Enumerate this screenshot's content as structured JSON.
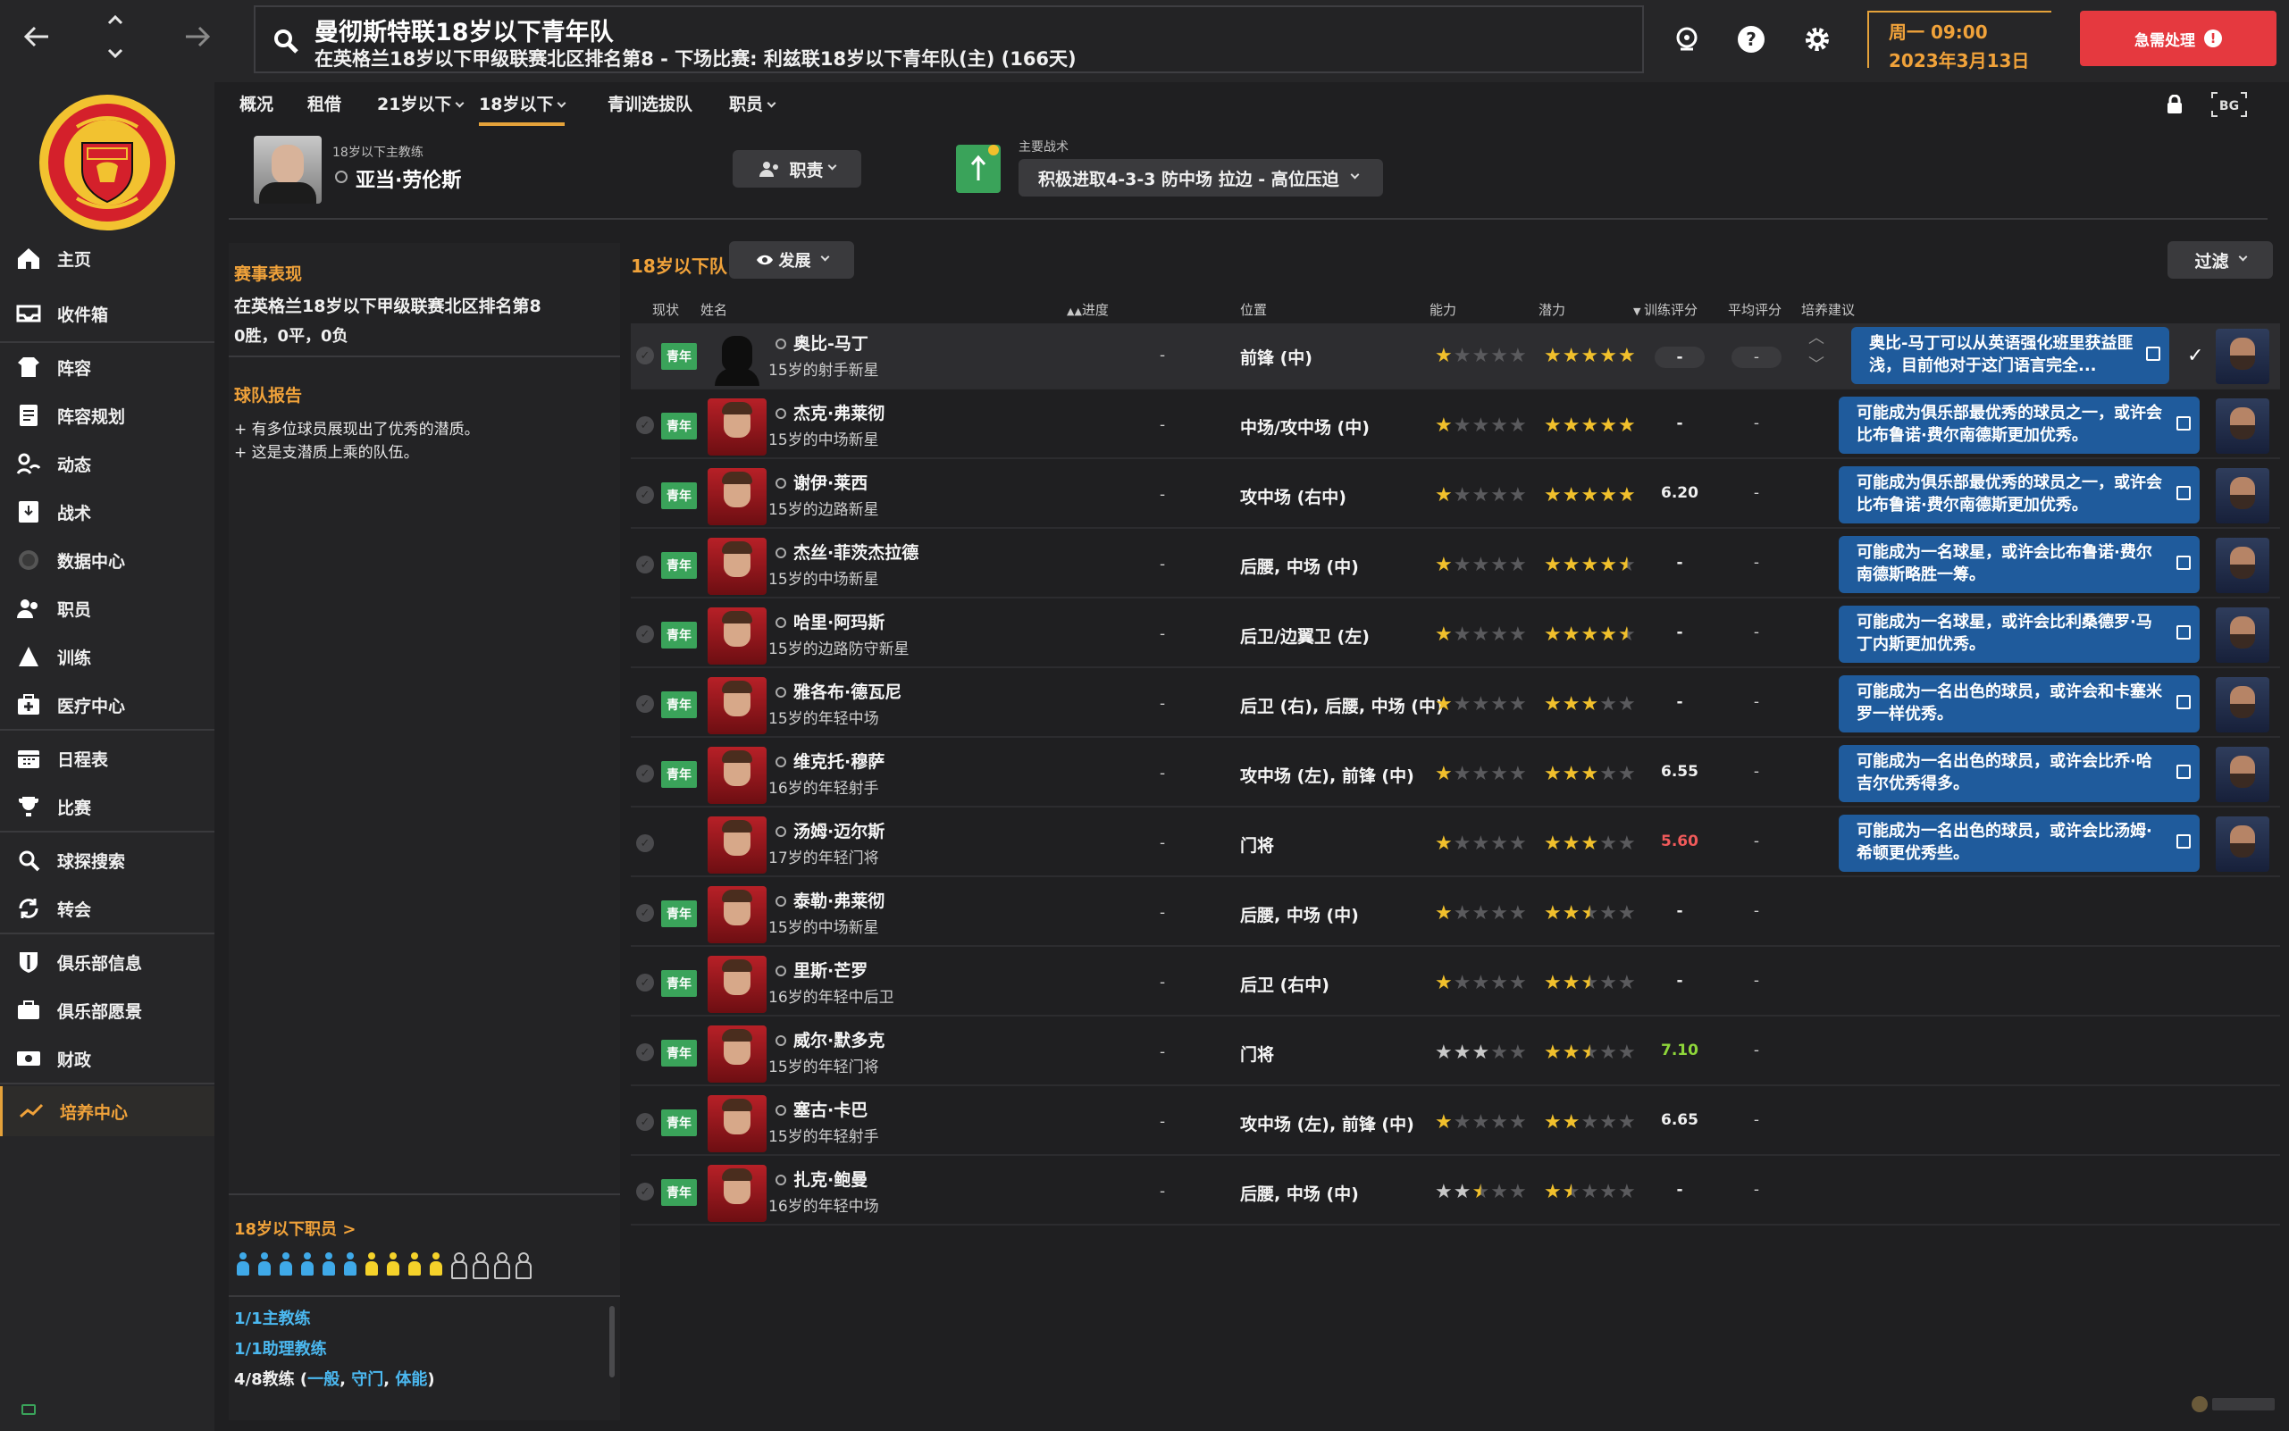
{
  "header": {
    "team_title": "曼彻斯特联18岁以下青年队",
    "team_sub": "在英格兰18岁以下甲级联赛北区排名第8 - 下场比赛: 利兹联18岁以下青年队(主) (166天)",
    "date_day": "周一 09:00",
    "date_full": "2023年3月13日",
    "urgent_label": "急需处理"
  },
  "sidebar": {
    "items": [
      {
        "label": "主页",
        "icon": "home-icon"
      },
      {
        "label": "收件箱",
        "icon": "inbox-icon"
      },
      {
        "label": "阵容",
        "icon": "squad-icon"
      },
      {
        "label": "阵容规划",
        "icon": "planner-icon"
      },
      {
        "label": "动态",
        "icon": "dynamics-icon"
      },
      {
        "label": "战术",
        "icon": "tactics-icon"
      },
      {
        "label": "数据中心",
        "icon": "data-icon"
      },
      {
        "label": "职员",
        "icon": "staff-icon"
      },
      {
        "label": "训练",
        "icon": "training-icon"
      },
      {
        "label": "医疗中心",
        "icon": "medical-icon"
      },
      {
        "label": "日程表",
        "icon": "calendar-icon"
      },
      {
        "label": "比赛",
        "icon": "trophy-icon"
      },
      {
        "label": "球探搜索",
        "icon": "scouting-icon"
      },
      {
        "label": "转会",
        "icon": "transfer-icon"
      },
      {
        "label": "俱乐部信息",
        "icon": "club-info-icon"
      },
      {
        "label": "俱乐部愿景",
        "icon": "vision-icon"
      },
      {
        "label": "财政",
        "icon": "finance-icon"
      },
      {
        "label": "培养中心",
        "icon": "development-icon"
      }
    ]
  },
  "subnav": {
    "tabs": [
      "概况",
      "租借",
      "21岁以下",
      "18岁以下",
      "青训选拔队",
      "职员"
    ]
  },
  "coach": {
    "role": "18岁以下主教练",
    "name": "亚当·劳伦斯",
    "duty_label": "职责",
    "tactic_label": "主要战术",
    "tactic_value": "积极进取4-3-3 防中场 拉边 - 高位压迫"
  },
  "info": {
    "competition_heading": "赛事表现",
    "competition_rank": "在英格兰18岁以下甲级联赛北区排名第8",
    "competition_record": "0胜，0平，0负",
    "report_heading": "球队报告",
    "report_lines": [
      "+ 有多位球员展现出了优秀的潜质。",
      "+ 这是支潜质上乘的队伍。"
    ],
    "staff_heading": "18岁以下职员 >",
    "staff_head_coach": "1/1主教练",
    "staff_assistant": "1/1助理教练",
    "staff_coaches_prefix": "4/8教练 (",
    "staff_coaches_general": "一般",
    "staff_coaches_gk": "守门",
    "staff_coaches_fitness": "体能",
    "staff_coaches_suffix": ")",
    "staff_dot_colors": [
      "#3fa9e8",
      "#3fa9e8",
      "#3fa9e8",
      "#3fa9e8",
      "#3fa9e8",
      "#3fa9e8",
      "#f5d22a",
      "#f5d22a",
      "#f5d22a",
      "#f5d22a",
      "empty",
      "empty",
      "empty",
      "empty"
    ]
  },
  "table": {
    "squad_label": "18岁以下队",
    "view_label": "发展",
    "filter_label": "过滤",
    "columns": {
      "status": "现状",
      "name": "姓名",
      "progress": "进度",
      "position": "位置",
      "ability": "能力",
      "potential": "潜力",
      "training": "训练评分",
      "avg": "平均评分",
      "advice": "培养建议"
    },
    "rows": [
      {
        "status": "青年",
        "name": "奥比-马丁",
        "desc": "15岁的射手新星",
        "progress": "-",
        "position": "前锋 (中)",
        "ability": 1,
        "potential": 5,
        "training": "-",
        "avg": "-",
        "advice": "奥比-马丁可以从英语强化班里获益匪浅，目前他对于这门语言完全...",
        "silhouette": true
      },
      {
        "status": "青年",
        "name": "杰克·弗莱彻",
        "desc": "15岁的中场新星",
        "progress": "-",
        "position": "中场/攻中场 (中)",
        "ability": 1,
        "potential": 5,
        "training": "-",
        "avg": "-",
        "advice": "可能成为俱乐部最优秀的球员之一，或许会比布鲁诺·费尔南德斯更加优秀。"
      },
      {
        "status": "青年",
        "name": "谢伊·莱西",
        "desc": "15岁的边路新星",
        "progress": "-",
        "position": "攻中场 (右中)",
        "ability": 1,
        "potential": 5,
        "training": "6.20",
        "avg": "-",
        "advice": "可能成为俱乐部最优秀的球员之一，或许会比布鲁诺·费尔南德斯更加优秀。"
      },
      {
        "status": "青年",
        "name": "杰丝·菲茨杰拉德",
        "desc": "15岁的中场新星",
        "progress": "-",
        "position": "后腰, 中场 (中)",
        "ability": 1,
        "potential": 4.5,
        "training": "-",
        "avg": "-",
        "advice": "可能成为一名球星，或许会比布鲁诺·费尔南德斯略胜一筹。"
      },
      {
        "status": "青年",
        "name": "哈里·阿玛斯",
        "desc": "15岁的边路防守新星",
        "progress": "-",
        "position": "后卫/边翼卫 (左)",
        "ability": 1,
        "potential": 4.5,
        "training": "-",
        "avg": "-",
        "advice": "可能成为一名球星，或许会比利桑德罗·马丁内斯更加优秀。"
      },
      {
        "status": "青年",
        "name": "雅各布·德瓦尼",
        "desc": "15岁的年轻中场",
        "progress": "-",
        "position": "后卫 (右), 后腰, 中场 (中)",
        "ability": 1,
        "potential": 3,
        "training": "-",
        "avg": "-",
        "advice": "可能成为一名出色的球员，或许会和卡塞米罗一样优秀。"
      },
      {
        "status": "青年",
        "name": "维克托·穆萨",
        "desc": "16岁的年轻射手",
        "progress": "-",
        "position": "攻中场 (左), 前锋 (中)",
        "ability": 1,
        "potential": 3,
        "training": "6.55",
        "avg": "-",
        "advice": "可能成为一名出色的球员，或许会比乔·哈吉尔优秀得多。"
      },
      {
        "status": "",
        "name": "汤姆·迈尔斯",
        "desc": "17岁的年轻门将",
        "progress": "-",
        "position": "门将",
        "ability": 1,
        "potential": 3,
        "training": "5.60",
        "training_color": "red",
        "avg": "-",
        "advice": "可能成为一名出色的球员，或许会比汤姆·希顿更优秀些。"
      },
      {
        "status": "青年",
        "name": "泰勒·弗莱彻",
        "desc": "15岁的中场新星",
        "progress": "-",
        "position": "后腰, 中场 (中)",
        "ability": 1,
        "potential": 2.5,
        "training": "-",
        "avg": "-",
        "advice": ""
      },
      {
        "status": "青年",
        "name": "里斯·芒罗",
        "desc": "16岁的年轻中后卫",
        "progress": "-",
        "position": "后卫 (右中)",
        "ability": 1,
        "potential": 2.5,
        "training": "-",
        "avg": "-",
        "advice": ""
      },
      {
        "status": "青年",
        "name": "威尔·默多克",
        "desc": "15岁的年轻门将",
        "progress": "-",
        "position": "门将",
        "ability": 3,
        "ability_grey": true,
        "potential": 2.5,
        "training": "7.10",
        "training_color": "green",
        "avg": "-",
        "advice": ""
      },
      {
        "status": "青年",
        "name": "塞古·卡巴",
        "desc": "15岁的年轻射手",
        "progress": "-",
        "position": "攻中场 (左), 前锋 (中)",
        "ability": 1,
        "potential": 2,
        "training": "6.65",
        "avg": "-",
        "advice": ""
      },
      {
        "status": "青年",
        "name": "扎克·鲍曼",
        "desc": "16岁的年轻中场",
        "progress": "-",
        "position": "后腰, 中场 (中)",
        "ability": 2.5,
        "ability_grey": true,
        "potential": 1.5,
        "training": "-",
        "avg": "-",
        "advice": ""
      }
    ]
  }
}
